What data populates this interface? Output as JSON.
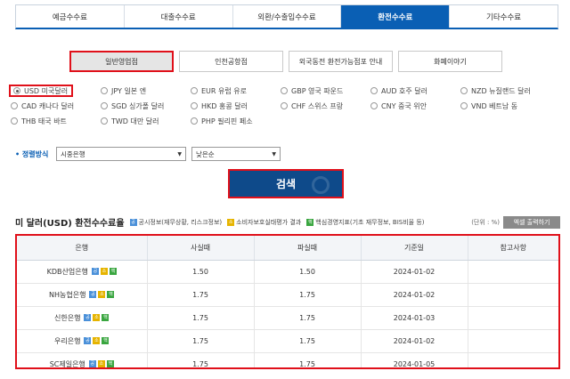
{
  "topnav": {
    "tabs": [
      {
        "label": "예금수수료",
        "active": false
      },
      {
        "label": "대출수수료",
        "active": false
      },
      {
        "label": "외환/수출입수수료",
        "active": false
      },
      {
        "label": "환전수수료",
        "active": true
      },
      {
        "label": "기타수수료",
        "active": false
      }
    ]
  },
  "subtabs": [
    {
      "label": "일반영업점",
      "active": true
    },
    {
      "label": "인천공항점",
      "active": false
    },
    {
      "label": "외국동전 환전가능점포 안내",
      "active": false
    },
    {
      "label": "화폐이야기",
      "active": false
    }
  ],
  "currencies": [
    {
      "label": "USD 미국달러",
      "selected": true
    },
    {
      "label": "JPY 일본 엔",
      "selected": false
    },
    {
      "label": "EUR 유럽 유로",
      "selected": false
    },
    {
      "label": "GBP 영국 파운드",
      "selected": false
    },
    {
      "label": "AUD 호주 달러",
      "selected": false
    },
    {
      "label": "NZD 뉴질랜드 달러",
      "selected": false
    },
    {
      "label": "CAD 캐나다 달러",
      "selected": false
    },
    {
      "label": "SGD 싱가폴 달러",
      "selected": false
    },
    {
      "label": "HKD 홍콩 달러",
      "selected": false
    },
    {
      "label": "CHF 스위스 프랑",
      "selected": false
    },
    {
      "label": "CNY 중국 위안",
      "selected": false
    },
    {
      "label": "VND 베트남 동",
      "selected": false
    },
    {
      "label": "THB 태국 바트",
      "selected": false
    },
    {
      "label": "TWD 대만 달러",
      "selected": false
    },
    {
      "label": "PHP 필리핀 페소",
      "selected": false
    }
  ],
  "sort": {
    "label": "정렬방식",
    "select1": "시중은행",
    "select2": "낮은순"
  },
  "search_label": "검색",
  "result": {
    "title": "미 달러(USD) 환전수수료율",
    "legend": [
      {
        "icon": "blue",
        "glyph": "공",
        "text": "공시정보(재무상황, 리스크정보)"
      },
      {
        "icon": "yellow",
        "glyph": "소",
        "text": "소비자보호실태평가 결과"
      },
      {
        "icon": "green",
        "glyph": "핵",
        "text": "핵심경영지표(기초 재무정보, BIS비율 등)"
      }
    ],
    "unit": "(단위 : %)",
    "excel_label": "엑셀 출력하기"
  },
  "table": {
    "headers": [
      "은행",
      "사실때",
      "파실때",
      "기준일",
      "참고사항"
    ],
    "rows": [
      {
        "bank": "KDB산업은행",
        "buy": "1.50",
        "sell": "1.50",
        "date": "2024-01-02",
        "note": ""
      },
      {
        "bank": "NH농협은행",
        "buy": "1.75",
        "sell": "1.75",
        "date": "2024-01-02",
        "note": ""
      },
      {
        "bank": "신한은행",
        "buy": "1.75",
        "sell": "1.75",
        "date": "2024-01-03",
        "note": ""
      },
      {
        "bank": "우리은행",
        "buy": "1.75",
        "sell": "1.75",
        "date": "2024-01-02",
        "note": ""
      },
      {
        "bank": "SC제일은행",
        "buy": "1.75",
        "sell": "1.75",
        "date": "2024-01-05",
        "note": ""
      }
    ]
  },
  "colors": {
    "accent_blue": "#0a5fb4",
    "highlight_red": "#e0101a",
    "search_bg": "#0e4a8a"
  }
}
